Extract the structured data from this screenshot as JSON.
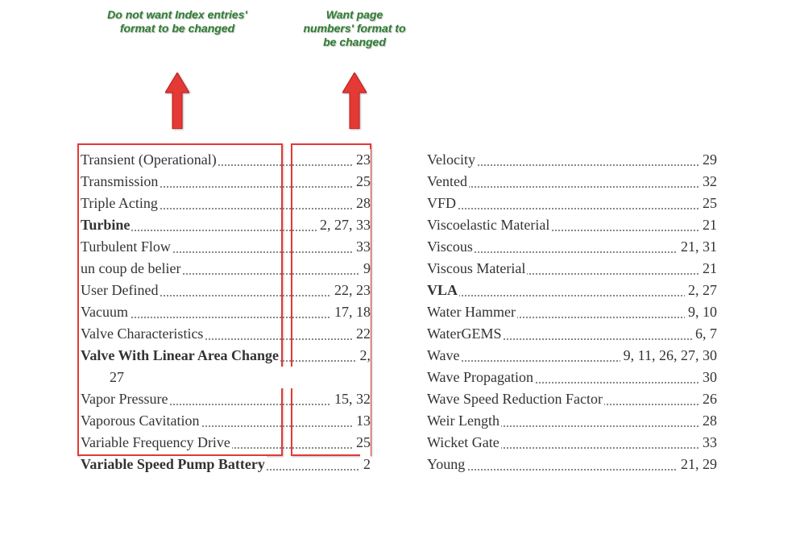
{
  "annotations": {
    "dont_change": "Do not want Index entries' format to be changed",
    "do_change": "Want page numbers' format to be changed"
  },
  "left_column": [
    {
      "term": "Transient (Operational)",
      "pages": "23",
      "bold": false
    },
    {
      "term": "Transmission",
      "pages": "25",
      "bold": false
    },
    {
      "term": "Triple Acting",
      "pages": "28",
      "bold": false
    },
    {
      "term": "Turbine",
      "pages": "2, 27, 33",
      "bold": true
    },
    {
      "term": "Turbulent Flow",
      "pages": "33",
      "bold": false
    },
    {
      "term": "un coup de belier",
      "pages": "9",
      "bold": false
    },
    {
      "term": "User Defined",
      "pages": "22, 23",
      "bold": false
    },
    {
      "term": "Vacuum",
      "pages": "17, 18",
      "bold": false
    },
    {
      "term": "Valve Characteristics",
      "pages": "22",
      "bold": false
    },
    {
      "term": "Valve With Linear Area Change",
      "pages": "2,",
      "bold": true,
      "cont": "27"
    },
    {
      "term": "Vapor Pressure",
      "pages": "15, 32",
      "bold": false
    },
    {
      "term": "Vaporous Cavitation",
      "pages": "13",
      "bold": false
    },
    {
      "term": "Variable Frequency Drive",
      "pages": "25",
      "bold": false
    },
    {
      "term": "Variable Speed Pump Battery",
      "pages": "2",
      "bold": true
    }
  ],
  "right_column": [
    {
      "term": "Velocity",
      "pages": "29",
      "bold": false
    },
    {
      "term": "Vented",
      "pages": "32",
      "bold": false
    },
    {
      "term": "VFD",
      "pages": "25",
      "bold": false
    },
    {
      "term": "Viscoelastic Material",
      "pages": "21",
      "bold": false
    },
    {
      "term": "Viscous",
      "pages": "21, 31",
      "bold": false
    },
    {
      "term": "Viscous Material",
      "pages": "21",
      "bold": false
    },
    {
      "term": "VLA",
      "pages": "2, 27",
      "bold": true
    },
    {
      "term": "Water Hammer",
      "pages": "9, 10",
      "bold": false
    },
    {
      "term": "WaterGEMS",
      "pages": "6, 7",
      "bold": false
    },
    {
      "term": "Wave",
      "pages": "9, 11, 26, 27, 30",
      "bold": false
    },
    {
      "term": "Wave Propagation",
      "pages": "30",
      "bold": false
    },
    {
      "term": "Wave Speed Reduction Factor",
      "pages": "26",
      "bold": false
    },
    {
      "term": "Weir Length",
      "pages": "28",
      "bold": false
    },
    {
      "term": "Wicket Gate",
      "pages": "33",
      "bold": false
    },
    {
      "term": "Young",
      "pages": "21, 29",
      "bold": false
    }
  ]
}
